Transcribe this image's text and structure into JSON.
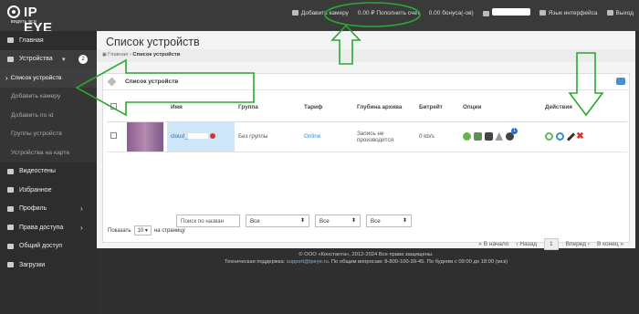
{
  "brand": {
    "word": "IP EYE",
    "tagline": "видеть все"
  },
  "topbar": {
    "add_camera": "Добавить камеру",
    "balance": "0.00 ₽ Пополнить счет",
    "bonus": "0.00 бонуса(-ов)",
    "language": "Язык интерфейса",
    "logout": "Выход"
  },
  "sidebar": {
    "items": [
      {
        "label": "Главная"
      },
      {
        "label": "Устройства",
        "badge": "2"
      },
      {
        "label": "Список устройств"
      },
      {
        "label": "Добавить камеру"
      },
      {
        "label": "Добавить по id"
      },
      {
        "label": "Группы устройств"
      },
      {
        "label": "Устройства на карте"
      },
      {
        "label": "Видеостены"
      },
      {
        "label": "Избранное"
      },
      {
        "label": "Профиль"
      },
      {
        "label": "Права доступа"
      },
      {
        "label": "Общий доступ"
      },
      {
        "label": "Загрузки"
      }
    ]
  },
  "main": {
    "title": "Список устройств",
    "breadcrumb": {
      "home": "Главная",
      "current": "Список устройств"
    },
    "panel_title": "Список устройств"
  },
  "table": {
    "headers": [
      "Имя",
      "Группа",
      "Тариф",
      "Глубина архива",
      "Битрейт",
      "Опции",
      "Действия"
    ],
    "row": {
      "name": "cloud_",
      "group": "Без группы",
      "tariff": "Online",
      "archive": "Запись не производится",
      "bitrate": "0 kb/s",
      "notifications": "1"
    }
  },
  "filters": {
    "search_placeholder": "Поиск по назван",
    "group": "Все",
    "tariff": "Все",
    "archive": "Все"
  },
  "pager": {
    "first": "« В начало",
    "prev": "‹ Назад",
    "page": "1",
    "next": "Вперед ›",
    "last": "В конец »"
  },
  "show": {
    "label": "Показать",
    "value": "10",
    "suffix": "на страницу"
  },
  "footer": {
    "copyright": "© ООО «Константа», 2012-2024 Все права защищены.",
    "support_label": "Техническая поддержка:",
    "support_email": "support@ipeye.ru",
    "general": ". По общим вопросам: 8-800-100-39-45. По будням с 09:00 до 18:00 (мск)"
  },
  "colors": {
    "annotation": "#2aa832",
    "link": "#2f8fcf"
  }
}
